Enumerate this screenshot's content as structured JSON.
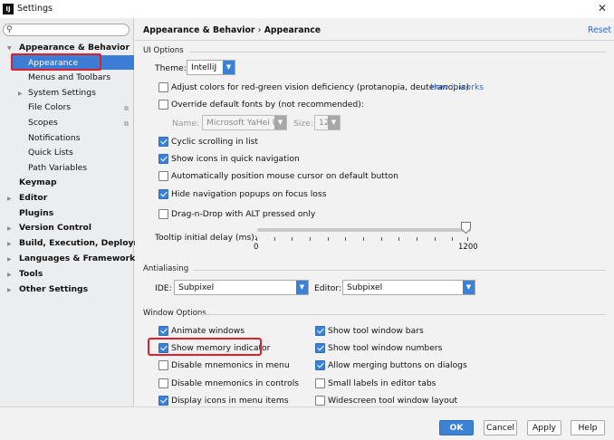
{
  "window": {
    "title": "Settings",
    "app_icon_text": "IJ",
    "close_glyph": "✕"
  },
  "search": {
    "placeholder": "",
    "icon": "search-icon"
  },
  "sidebar": {
    "items": [
      {
        "label": "Appearance & Behavior",
        "bold": true
      },
      {
        "label": "Appearance",
        "selected": true
      },
      {
        "label": "Menus and Toolbars"
      },
      {
        "label": "System Settings"
      },
      {
        "label": "File Colors"
      },
      {
        "label": "Scopes"
      },
      {
        "label": "Notifications"
      },
      {
        "label": "Quick Lists"
      },
      {
        "label": "Path Variables"
      },
      {
        "label": "Keymap",
        "bold": true
      },
      {
        "label": "Editor",
        "bold": true
      },
      {
        "label": "Plugins",
        "bold": true
      },
      {
        "label": "Version Control",
        "bold": true
      },
      {
        "label": "Build, Execution, Deployment",
        "bold": true
      },
      {
        "label": "Languages & Frameworks",
        "bold": true
      },
      {
        "label": "Tools",
        "bold": true
      },
      {
        "label": "Other Settings",
        "bold": true
      }
    ]
  },
  "header": {
    "breadcrumb_parent": "Appearance & Behavior",
    "breadcrumb_sep": "›",
    "breadcrumb_current": "Appearance",
    "reset_label": "Reset"
  },
  "ui_options": {
    "section_label": "UI Options",
    "theme_label": "Theme:",
    "theme_value": "IntelliJ",
    "adjust_colors": {
      "label": "Adjust colors for red-green vision deficiency (protanopia, deuteranopia)",
      "checked": false
    },
    "how_it_works": "How it works",
    "override_fonts": {
      "label": "Override default fonts by (not recommended):",
      "checked": false
    },
    "font_name_label": "Name:",
    "font_name_value": "Microsoft YaHei UI",
    "font_size_label": "Size:",
    "font_size_value": "12",
    "cyclic_scrolling": {
      "label": "Cyclic scrolling in list",
      "checked": true
    },
    "show_icons_nav": {
      "label": "Show icons in quick navigation",
      "checked": true
    },
    "auto_position_mouse": {
      "label": "Automatically position mouse cursor on default button",
      "checked": false
    },
    "hide_nav_popups": {
      "label": "Hide navigation popups on focus loss",
      "checked": true
    },
    "drag_n_drop_alt": {
      "label": "Drag-n-Drop with ALT pressed only",
      "checked": false
    },
    "tooltip_delay_label": "Tooltip initial delay (ms):",
    "tooltip_min": "0",
    "tooltip_max": "1200",
    "tooltip_value": 1200
  },
  "antialiasing": {
    "section_label": "Antialiasing",
    "ide_label": "IDE:",
    "ide_value": "Subpixel",
    "editor_label": "Editor:",
    "editor_value": "Subpixel"
  },
  "window_options": {
    "section_label": "Window Options",
    "animate_windows": {
      "label": "Animate windows",
      "checked": true
    },
    "show_memory": {
      "label": "Show memory indicator",
      "checked": true
    },
    "disable_mnemonics_menu": {
      "label": "Disable mnemonics in menu",
      "checked": false
    },
    "disable_mnemonics_controls": {
      "label": "Disable mnemonics in controls",
      "checked": false
    },
    "display_icons_menu": {
      "label": "Display icons in menu items",
      "checked": true
    },
    "show_tool_window_bars": {
      "label": "Show tool window bars",
      "checked": true
    },
    "show_tool_window_numbers": {
      "label": "Show tool window numbers",
      "checked": true
    },
    "allow_merging_buttons": {
      "label": "Allow merging buttons on dialogs",
      "checked": true
    },
    "small_labels_tabs": {
      "label": "Small labels in editor tabs",
      "checked": false
    },
    "widescreen_layout": {
      "label": "Widescreen tool window layout",
      "checked": false
    }
  },
  "footer": {
    "ok": "OK",
    "cancel": "Cancel",
    "apply": "Apply",
    "help": "Help"
  },
  "colors": {
    "accent": "#3b82d6",
    "highlight_outline": "#e01f28",
    "link": "#3467ce"
  }
}
